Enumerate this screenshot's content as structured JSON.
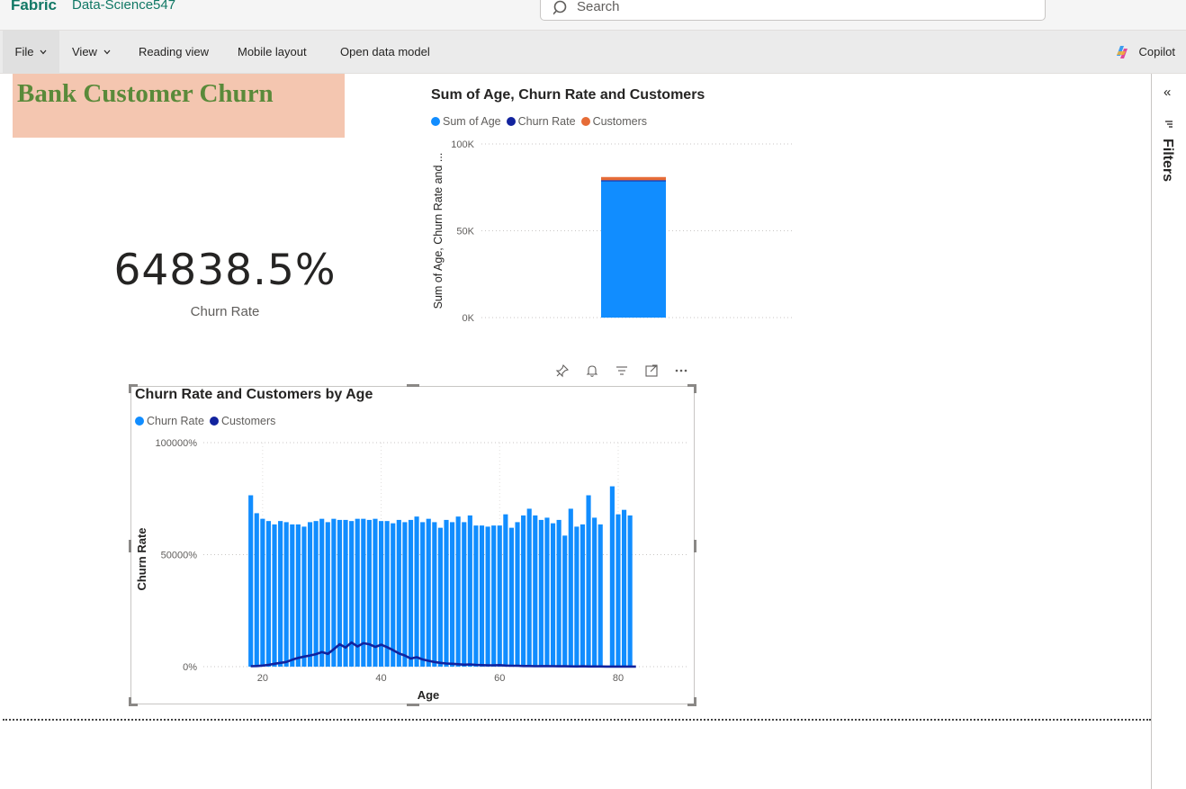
{
  "app": {
    "brand": "Fabric",
    "workspace": "Data-Science547"
  },
  "search": {
    "placeholder": "Search"
  },
  "ribbon": {
    "file": "File",
    "view": "View",
    "reading_view": "Reading view",
    "mobile_layout": "Mobile layout",
    "open_data_model": "Open data model",
    "copilot": "Copilot"
  },
  "filters": {
    "label": "Filters",
    "collapse_glyph": "«"
  },
  "report": {
    "title": "Bank Customer Churn",
    "card": {
      "value": "64838.5%",
      "label": "Churn Rate"
    }
  },
  "colors": {
    "blue": "#118DFF",
    "navy": "#12239E",
    "orange": "#E66C37",
    "title_bg": "#F4C6B0",
    "title_text": "#5A8A3A"
  },
  "chart_data": [
    {
      "type": "bar",
      "stacked": true,
      "title": "Sum of Age, Churn Rate and Customers",
      "ylabel": "Sum of Age, Churn Rate and ...",
      "yticks": [
        "100K",
        "50K",
        "0K"
      ],
      "ylim": [
        0,
        100000
      ],
      "grid": true,
      "legend_position": "top-left",
      "series": [
        {
          "name": "Sum of Age",
          "values": [
            78500
          ],
          "color": "#118DFF"
        },
        {
          "name": "Churn Rate",
          "values": [
            650
          ],
          "color": "#12239E"
        },
        {
          "name": "Customers",
          "values": [
            1800
          ],
          "color": "#E66C37"
        }
      ]
    },
    {
      "type": "bar",
      "title": "Churn Rate and Customers by Age",
      "xlabel": "Age",
      "ylabel": "Churn Rate",
      "xticks": [
        "20",
        "40",
        "60",
        "80"
      ],
      "yticks": [
        "100000%",
        "50000%",
        "0%"
      ],
      "xlim": [
        10,
        92
      ],
      "ylim": [
        0,
        100000
      ],
      "grid": true,
      "legend_position": "top-left",
      "series": [
        {
          "name": "Churn Rate",
          "color": "#118DFF",
          "x": [
            18,
            19,
            20,
            21,
            22,
            23,
            24,
            25,
            26,
            27,
            28,
            29,
            30,
            31,
            32,
            33,
            34,
            35,
            36,
            37,
            38,
            39,
            40,
            41,
            42,
            43,
            44,
            45,
            46,
            47,
            48,
            49,
            50,
            51,
            52,
            53,
            54,
            55,
            56,
            57,
            58,
            59,
            60,
            61,
            62,
            63,
            64,
            65,
            66,
            67,
            68,
            69,
            70,
            71,
            72,
            73,
            74,
            75,
            76,
            77,
            78,
            79,
            80,
            81,
            82,
            83
          ],
          "values": [
            76500,
            68500,
            66000,
            65000,
            63500,
            65000,
            64500,
            63500,
            63500,
            62500,
            64500,
            65000,
            66000,
            64500,
            66000,
            65500,
            65500,
            65000,
            66000,
            66000,
            65500,
            66000,
            65000,
            65000,
            64000,
            65500,
            64500,
            65500,
            67000,
            64500,
            66000,
            64500,
            62000,
            65500,
            64500,
            67000,
            64500,
            67500,
            63000,
            63000,
            62500,
            63000,
            63000,
            68000,
            62000,
            64500,
            67500,
            70500,
            67500,
            65500,
            66500,
            64000,
            65500,
            58500,
            70500,
            62500,
            63500,
            76500,
            66500,
            63500,
            0,
            80500,
            68000,
            70000,
            67500,
            0
          ]
        },
        {
          "name": "Customers",
          "color": "#12239E",
          "x": [
            18,
            19,
            20,
            21,
            22,
            23,
            24,
            25,
            26,
            27,
            28,
            29,
            30,
            31,
            32,
            33,
            34,
            35,
            36,
            37,
            38,
            39,
            40,
            41,
            42,
            43,
            44,
            45,
            46,
            47,
            48,
            49,
            50,
            51,
            52,
            53,
            54,
            55,
            56,
            57,
            58,
            59,
            60,
            61,
            62,
            63,
            64,
            65,
            66,
            67,
            68,
            69,
            70,
            71,
            72,
            73,
            74,
            75,
            76,
            77,
            78,
            79,
            80,
            81,
            82,
            83
          ],
          "values": [
            200,
            300,
            500,
            800,
            1300,
            1700,
            2100,
            3100,
            3900,
            4500,
            5000,
            5600,
            6500,
            5700,
            7800,
            10000,
            8500,
            10800,
            9000,
            10500,
            10000,
            8800,
            9800,
            8700,
            7400,
            5900,
            5000,
            3600,
            4200,
            3200,
            2600,
            2100,
            1700,
            1400,
            1300,
            1100,
            900,
            1000,
            800,
            700,
            600,
            600,
            700,
            500,
            400,
            400,
            300,
            300,
            200,
            250,
            250,
            200,
            150,
            150,
            120,
            100,
            150,
            100,
            80,
            100,
            60,
            60,
            50,
            60,
            40,
            30
          ]
        }
      ]
    }
  ]
}
